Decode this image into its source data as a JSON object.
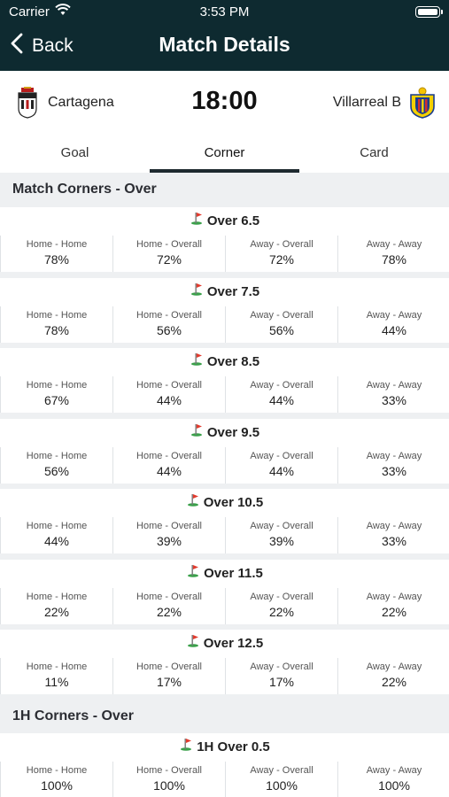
{
  "status_bar": {
    "carrier": "Carrier",
    "time": "3:53 PM"
  },
  "nav": {
    "back_label": "Back",
    "title": "Match Details"
  },
  "match": {
    "home_team": "Cartagena",
    "away_team": "Villarreal B",
    "kickoff": "18:00"
  },
  "tabs": [
    {
      "label": "Goal",
      "active": false
    },
    {
      "label": "Corner",
      "active": true
    },
    {
      "label": "Card",
      "active": false
    }
  ],
  "columns": [
    "Home - Home",
    "Home - Overall",
    "Away - Overall",
    "Away - Away"
  ],
  "sections": [
    {
      "title": "Match Corners - Over",
      "lines": [
        {
          "label": "Over 6.5",
          "values": [
            "78%",
            "72%",
            "72%",
            "78%"
          ]
        },
        {
          "label": "Over 7.5",
          "values": [
            "78%",
            "56%",
            "56%",
            "44%"
          ]
        },
        {
          "label": "Over 8.5",
          "values": [
            "67%",
            "44%",
            "44%",
            "33%"
          ]
        },
        {
          "label": "Over 9.5",
          "values": [
            "56%",
            "44%",
            "44%",
            "33%"
          ]
        },
        {
          "label": "Over 10.5",
          "values": [
            "44%",
            "39%",
            "39%",
            "33%"
          ]
        },
        {
          "label": "Over 11.5",
          "values": [
            "22%",
            "22%",
            "22%",
            "22%"
          ]
        },
        {
          "label": "Over 12.5",
          "values": [
            "11%",
            "17%",
            "17%",
            "22%"
          ]
        }
      ]
    },
    {
      "title": "1H Corners - Over",
      "lines": [
        {
          "label": "1H Over 0.5",
          "values": [
            "100%",
            "100%",
            "100%",
            "100%"
          ]
        }
      ]
    }
  ],
  "icons": {
    "back": "chevron-left-icon",
    "wifi": "wifi-icon",
    "battery": "battery-icon",
    "corner_flag": "corner-flag-icon",
    "home_logo": "cartagena-crest-icon",
    "away_logo": "villarreal-crest-icon"
  },
  "colors": {
    "nav_bg": "#0e2a30",
    "tab_indicator": "#1e2a30",
    "flag_red": "#e23b2e",
    "flag_green": "#3aa04a"
  }
}
